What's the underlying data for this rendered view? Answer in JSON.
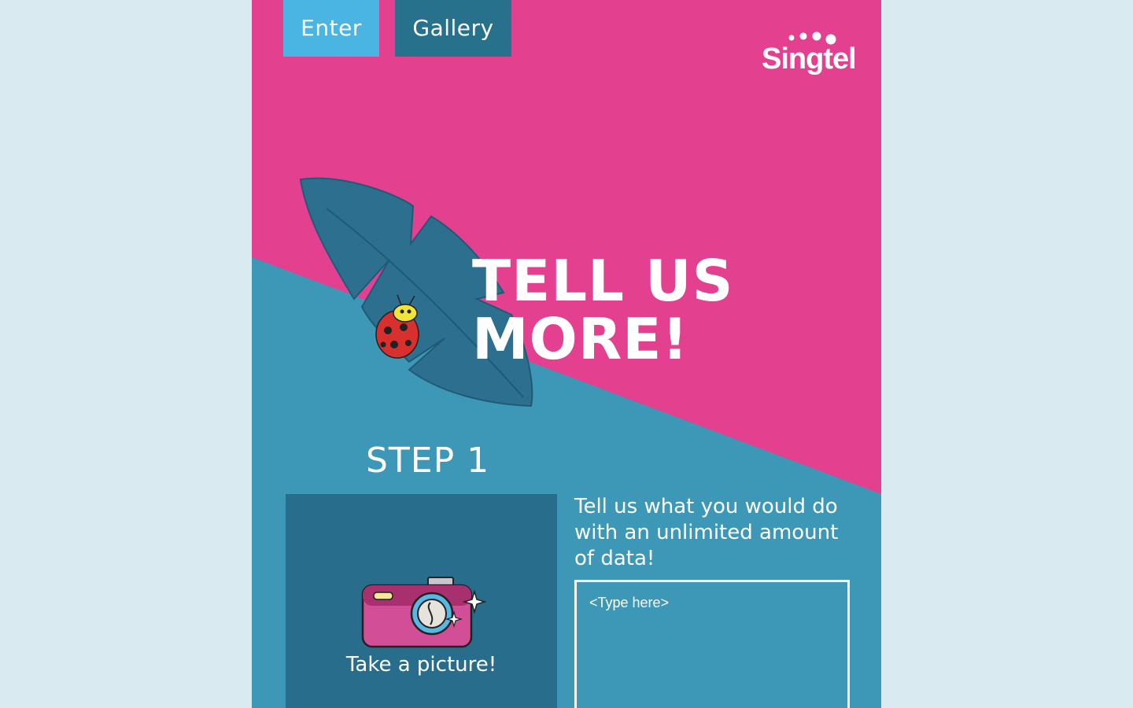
{
  "nav": {
    "enter_label": "Enter",
    "gallery_label": "Gallery"
  },
  "brand": {
    "logo_text": "Singtel"
  },
  "hero": {
    "line1": "TELL US",
    "line2": "MORE!"
  },
  "step": {
    "title": "STEP 1"
  },
  "picture_card": {
    "label": "Take a picture!",
    "icon": "camera-icon"
  },
  "prompt": {
    "text": "Tell us what you would do with an unlimited amount of data!"
  },
  "answer": {
    "placeholder": "<Type here>",
    "value": ""
  },
  "colors": {
    "page_bg": "#d9ebf1",
    "pink": "#e3418f",
    "teal": "#3d97b6",
    "dark_teal": "#286e8c",
    "light_blue": "#4ab4e2",
    "leaf": "#2c6f8e"
  },
  "illustrations": [
    "leaf-icon",
    "ladybug-icon"
  ]
}
